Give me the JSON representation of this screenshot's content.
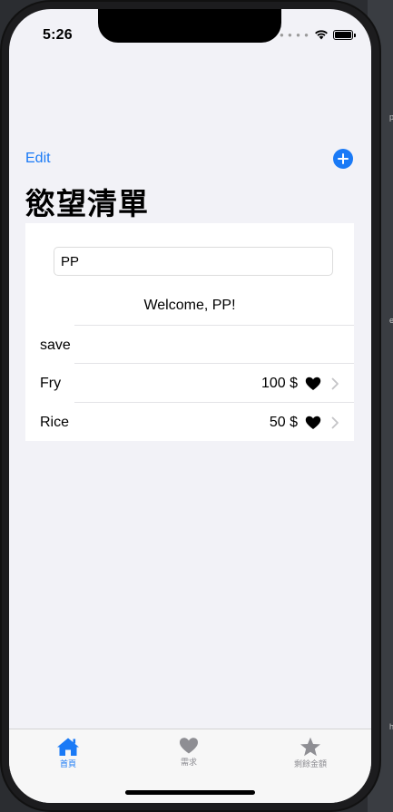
{
  "status_bar": {
    "time": "5:26"
  },
  "nav": {
    "edit_label": "Edit",
    "title": "慾望清單"
  },
  "form": {
    "name_value": "PP",
    "welcome": "Welcome, PP!"
  },
  "list": {
    "save_label": "save",
    "items": [
      {
        "name": "Fry",
        "price": "100 $"
      },
      {
        "name": "Rice",
        "price": "50 $"
      }
    ]
  },
  "tabs": [
    {
      "label": "首頁",
      "icon": "house-icon",
      "active": true
    },
    {
      "label": "需求",
      "icon": "heart-icon",
      "active": false
    },
    {
      "label": "剩餘金額",
      "icon": "star-icon",
      "active": false
    }
  ],
  "colors": {
    "accent": "#1a7af6",
    "inactive_tab": "#8e8e93",
    "background": "#f2f2f7"
  }
}
